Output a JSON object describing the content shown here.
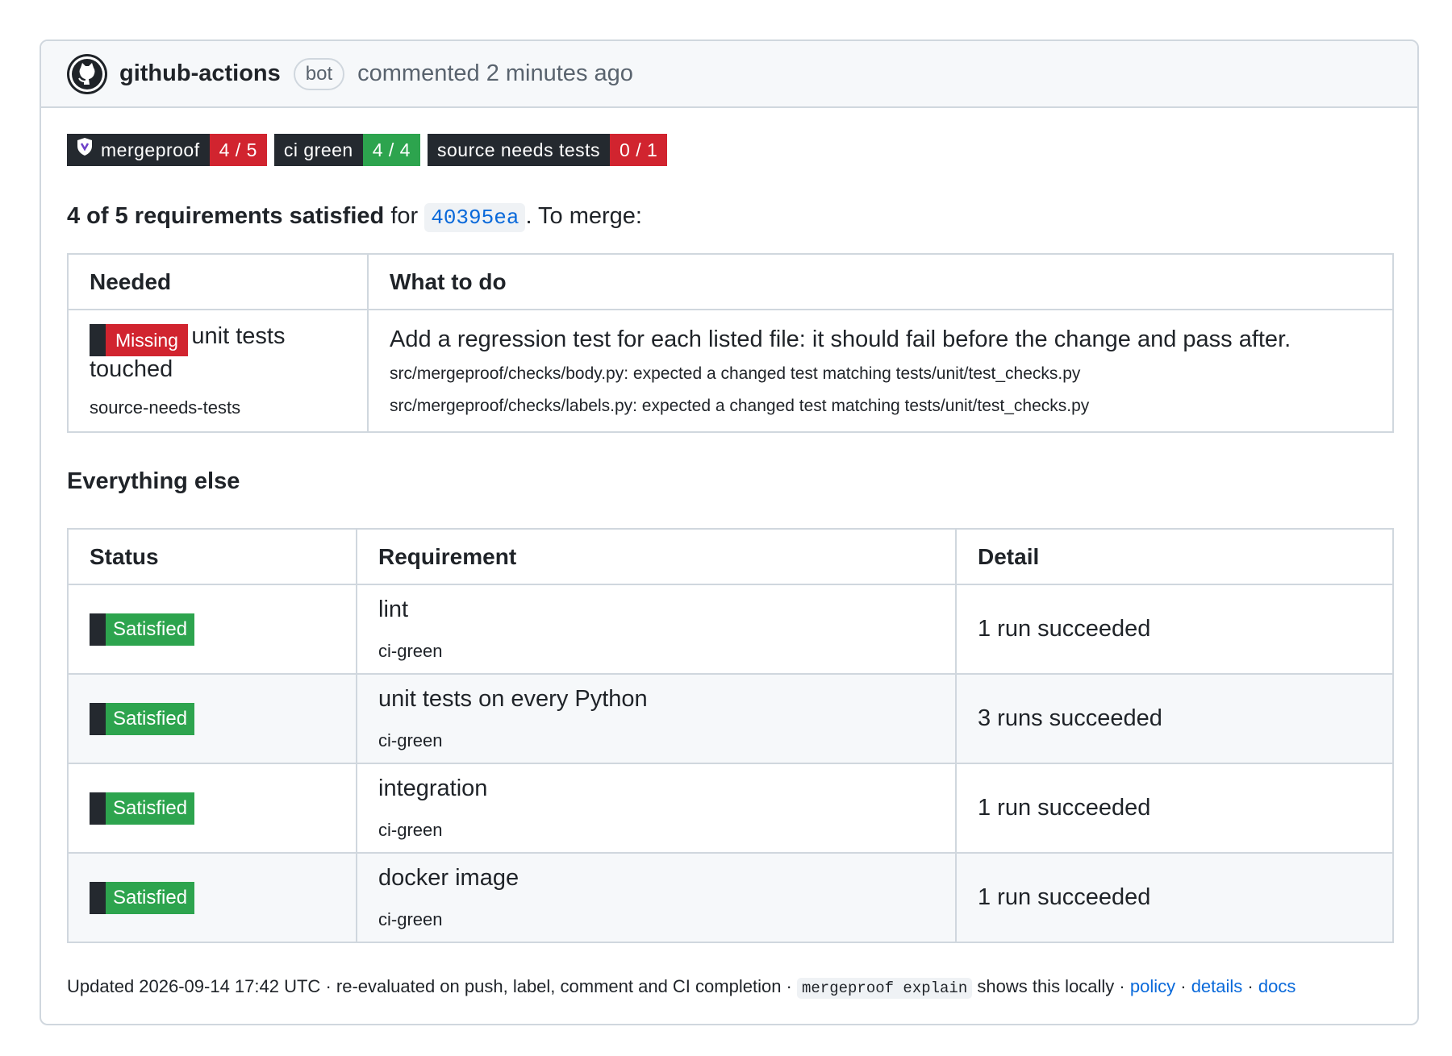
{
  "header": {
    "author": "github-actions",
    "bot_label": "bot",
    "meta": "commented 2 minutes ago"
  },
  "badges": [
    {
      "label": "mergeproof",
      "value": "4 / 5",
      "value_color": "#d1242f"
    },
    {
      "label": "ci green",
      "value": "4 / 4",
      "value_color": "#2da44e"
    },
    {
      "label": "source needs tests",
      "value": "0 / 1",
      "value_color": "#d1242f"
    }
  ],
  "summary": {
    "bold": "4 of 5 requirements satisfied",
    "for": "for",
    "sha": "40395ea",
    "suffix": ". To merge:"
  },
  "needed_table": {
    "headers": [
      "Needed",
      "What to do"
    ],
    "row": {
      "status": "Missing",
      "requirement": "unit tests touched",
      "requirement_id": "source-needs-tests",
      "instruction": "Add a regression test for each listed file: it should fail before the change and pass after.",
      "files": [
        "src/mergeproof/checks/body.py: expected a changed test matching tests/unit/test_checks.py",
        "src/mergeproof/checks/labels.py: expected a changed test matching tests/unit/test_checks.py"
      ]
    }
  },
  "everything_else": {
    "heading": "Everything else",
    "headers": [
      "Status",
      "Requirement",
      "Detail"
    ],
    "rows": [
      {
        "status": "Satisfied",
        "requirement": "lint",
        "requirement_id": "ci-green",
        "detail": "1 run succeeded"
      },
      {
        "status": "Satisfied",
        "requirement": "unit tests on every Python",
        "requirement_id": "ci-green",
        "detail": "3 runs succeeded"
      },
      {
        "status": "Satisfied",
        "requirement": "integration",
        "requirement_id": "ci-green",
        "detail": "1 run succeeded"
      },
      {
        "status": "Satisfied",
        "requirement": "docker image",
        "requirement_id": "ci-green",
        "detail": "1 run succeeded"
      }
    ]
  },
  "footer": {
    "updated": "Updated 2026-09-14 17:42 UTC",
    "sep": " · ",
    "reevaluated": "re-evaluated on push, label, comment and CI completion",
    "command": "mergeproof explain",
    "shows": "shows this locally",
    "links": [
      "policy",
      "details",
      "docs"
    ]
  },
  "colors": {
    "red": "#d1242f",
    "green": "#2da44e",
    "link": "#0969da"
  },
  "icons": {
    "avatar": "github-mark-icon",
    "badge": "shield-icon"
  }
}
